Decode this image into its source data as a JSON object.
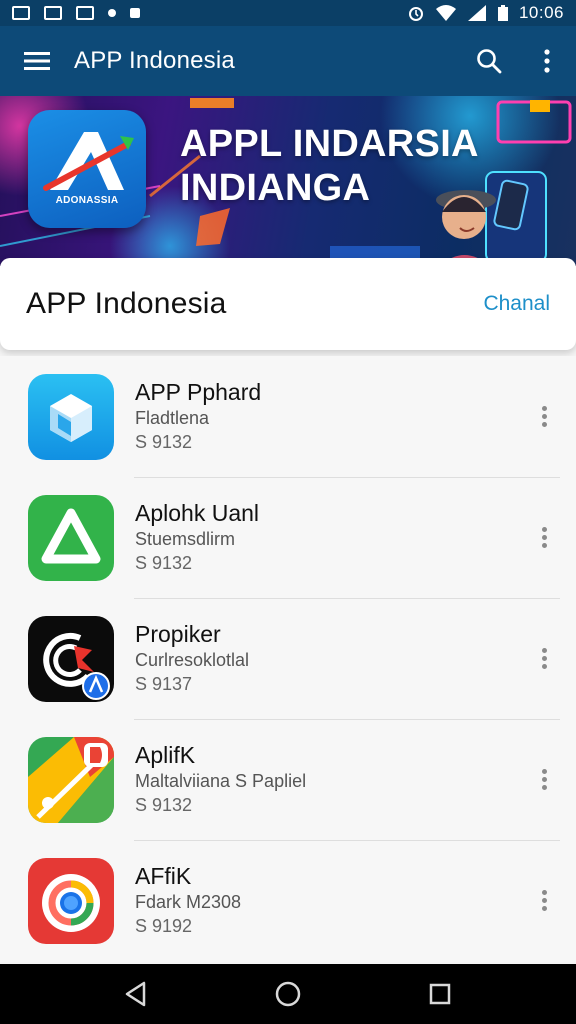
{
  "status_bar": {
    "time": "10:06",
    "icons": [
      "image-notification-icon",
      "gallery-notification-icon",
      "app-notification-icon",
      "dot-notification-icon",
      "square-notification-icon",
      "alarm-icon",
      "wifi-icon",
      "signal-icon",
      "battery-icon"
    ]
  },
  "app_bar": {
    "title": "APP Indonesia",
    "menu_icon": "hamburger-menu-icon",
    "search_icon": "search-icon",
    "more_icon": "more-vert-icon"
  },
  "banner": {
    "logo_text": "ADONASSIA",
    "headline_line1": "APPL INDARSIA",
    "headline_line2": "INDIANGA"
  },
  "section": {
    "title": "APP Indonesia",
    "link_label": "Chanal"
  },
  "apps": [
    {
      "name": "APP Pphard",
      "subtitle": "Fladtlena",
      "size": "S 9132"
    },
    {
      "name": "Aplohk Uanl",
      "subtitle": "Stuemsdlirm",
      "size": "S 9132"
    },
    {
      "name": "Propiker",
      "subtitle": "Curlresoklotlal",
      "size": "S 9137"
    },
    {
      "name": "AplifK",
      "subtitle": "Maltalviiana S Papliel",
      "size": "S 9132"
    },
    {
      "name": "AFfiK",
      "subtitle": "Fdark M2308",
      "size": "S 9192"
    }
  ],
  "colors": {
    "app_bar": "#0d4a78",
    "status_bar": "#0b3f66",
    "accent_link": "#1d8fc9",
    "nav_bar": "#000000"
  }
}
